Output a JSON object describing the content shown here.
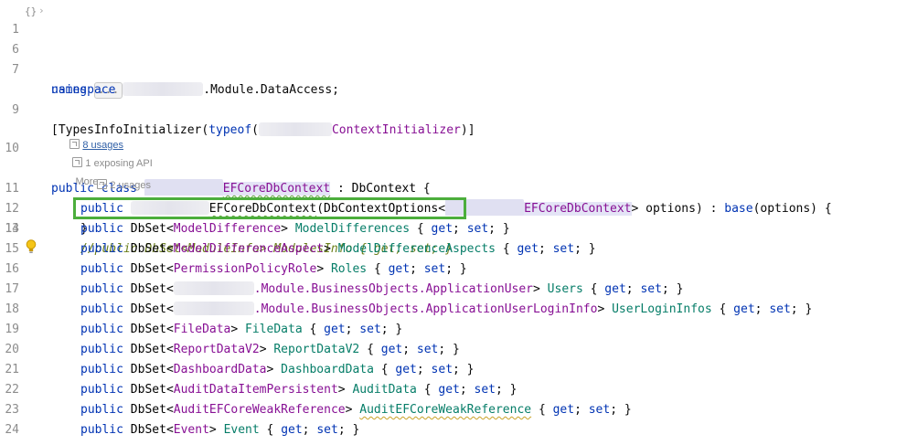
{
  "gutter": {
    "line_numbers": [
      "1",
      "6",
      "7",
      "9",
      "10",
      "11",
      "12",
      "13",
      "14",
      "15",
      "16",
      "17",
      "18",
      "19",
      "20",
      "21",
      "22",
      "23",
      "24"
    ]
  },
  "hints": {
    "class_usages": "8 usages",
    "exposing_api": "1 exposing API",
    "more": "More...",
    "ctor_usages": "2 usages"
  },
  "code": {
    "l1_using": "using",
    "l1_fold": "...",
    "l7_namespace_kw": "namespace",
    "l7_namespace_rest": ".Module.DataAccess;",
    "l9_open": "[TypesInfoInitializer(",
    "l9_typeof": "typeof",
    "l9_paren": "(",
    "l9_class": "ContextInitializer",
    "l9_close": ")]",
    "l10_public": "public",
    "l10_class_kw": "class",
    "l10_class_name": "EFCoreDbContext",
    "l10_sep": " : ",
    "l10_base": "DbContext",
    "l10_brace": " {",
    "l11_public": "public",
    "l11_name": "EFCoreDbContext",
    "l11_open": "(",
    "l11_param_type": "DbContextOptions",
    "l11_lt": "<",
    "l11_generic": "EFCoreDbContext",
    "l11_gt": "> options) : ",
    "l11_base": "base",
    "l11_tail": "(options) {",
    "l12_close": "}",
    "l13_comment": "//public DbSet<ModuleInfo> ModulesInfo { get; set; }",
    "accessors": "{ get; set; }",
    "dbsets": [
      {
        "type": "ModelDifference",
        "name": "ModelDifferences"
      },
      {
        "type": "ModelDifferenceAspect",
        "name": "ModelDifferenceAspects"
      },
      {
        "type": "PermissionPolicyRole",
        "name": "Roles"
      },
      {
        "type": ".Module.BusinessObjects.ApplicationUser",
        "name": "Users"
      },
      {
        "type": ".Module.BusinessObjects.ApplicationUserLoginInfo",
        "name": "UserLoginInfos"
      },
      {
        "type": "FileData",
        "name": "FileData"
      },
      {
        "type": "ReportDataV2",
        "name": "ReportDataV2"
      },
      {
        "type": "DashboardData",
        "name": "DashboardData"
      },
      {
        "type": "AuditDataItemPersistent",
        "name": "AuditData"
      },
      {
        "type": "AuditEFCoreWeakReference",
        "name": "AuditEFCoreWeakReference"
      },
      {
        "type": "Event",
        "name": "Event"
      }
    ],
    "public_kw": "public",
    "dbset_kw": "DbSet"
  },
  "colors": {
    "keyword": "#0033b3",
    "class": "#871094",
    "property": "#067d68",
    "comment": "#6b7f1a",
    "highlight_box": "#4cae3c"
  },
  "icons": {
    "fold_braces": "code-fold-icon",
    "intention_bulb": "lightbulb-icon"
  }
}
